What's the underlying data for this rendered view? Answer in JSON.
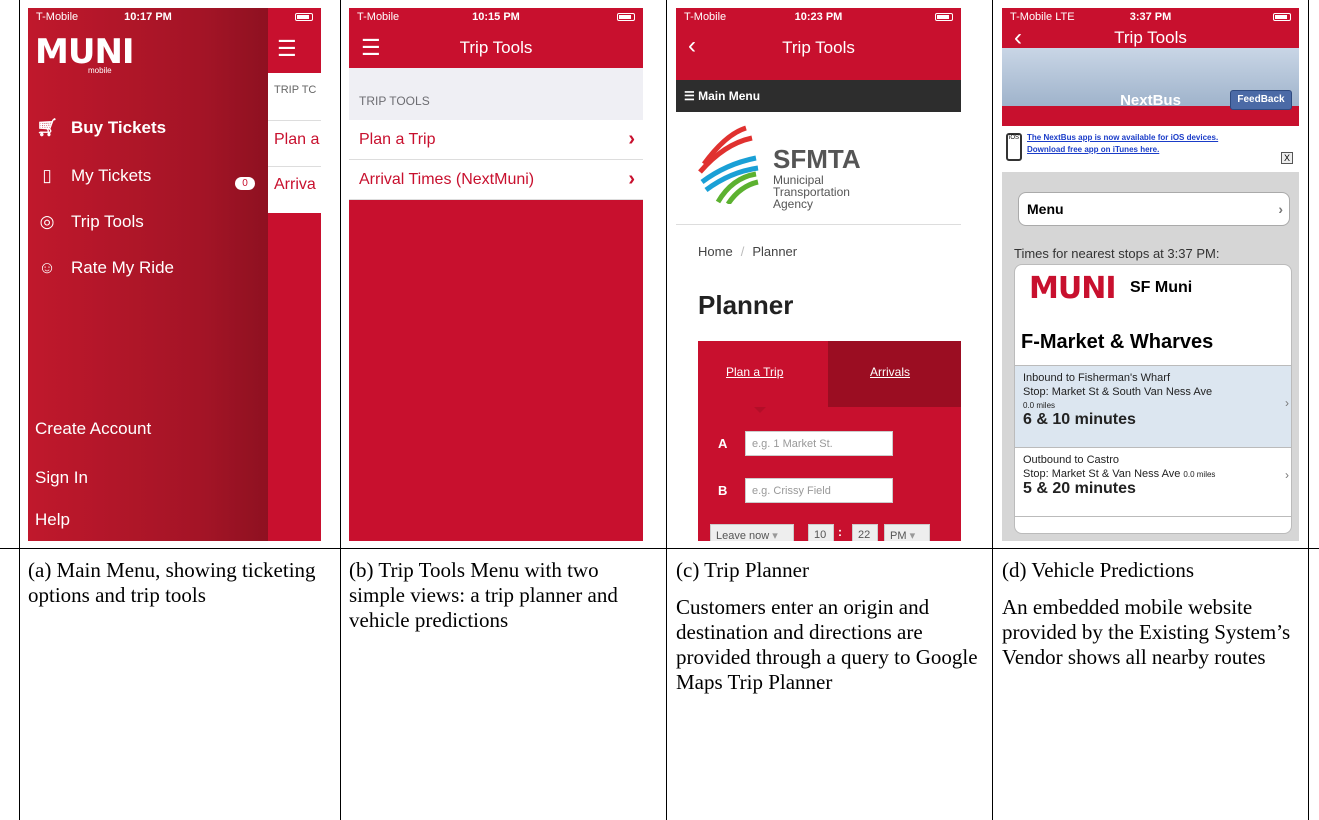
{
  "panel_a": {
    "status": {
      "carrier": "T-Mobile",
      "time": "10:17 PM"
    },
    "logo_text": "MUNI",
    "logo_sub": "mobile",
    "rest_header": "TRIP TC",
    "rest_row1": "Plan a",
    "rest_row2": "Arriva",
    "items": [
      {
        "icon": "cart-icon",
        "label": "Buy Tickets"
      },
      {
        "icon": "ticket-icon",
        "label": "My Tickets"
      },
      {
        "icon": "location-icon",
        "label": "Trip Tools"
      },
      {
        "icon": "smile-icon",
        "label": "Rate My Ride"
      }
    ],
    "ticket_count": "0",
    "bottom": [
      "Create Account",
      "Sign In",
      "Help"
    ],
    "caption": "(a) Main Menu, showing ticketing options and trip tools"
  },
  "panel_b": {
    "status": {
      "carrier": "T-Mobile",
      "time": "10:15 PM"
    },
    "title": "Trip Tools",
    "section": "TRIP TOOLS",
    "rows": [
      "Plan a Trip",
      "Arrival Times (NextMuni)"
    ],
    "caption": "(b) Trip Tools Menu with two simple views: a trip planner and vehicle predictions"
  },
  "panel_c": {
    "status": {
      "carrier": "T-Mobile",
      "time": "10:23 PM"
    },
    "title": "Trip Tools",
    "main_menu": "Main Menu",
    "sfmta": "SFMTA",
    "sfmta_sub": [
      "Municipal",
      "Transportation",
      "Agency"
    ],
    "crumb_home": "Home",
    "crumb_planner": "Planner",
    "planner_title": "Planner",
    "tab_plan": "Plan a Trip",
    "tab_arrivals": "Arrivals",
    "label_a": "A",
    "label_b": "B",
    "placeholder_a": "e.g. 1 Market St.",
    "placeholder_b": "e.g. Crissy Field",
    "leave": "Leave now",
    "hour": "10",
    "minute": "22",
    "ampm": "PM",
    "caption_title": "(c) Trip Planner",
    "caption_body": "Customers enter an origin and destination and directions are provided through a query to Google Maps Trip Planner"
  },
  "panel_d": {
    "status": {
      "carrier": "T-Mobile LTE",
      "time": "3:37 PM"
    },
    "title": "Trip Tools",
    "nextbus": "NextBus",
    "feedback": "FeedBack",
    "banner_ios": "iOS",
    "banner_l1": "The NextBus app is now available for iOS devices.",
    "banner_l2": "Download free app on iTunes here.",
    "banner_close": "X",
    "menu": "Menu",
    "times": "Times for nearest stops at 3:37 PM:",
    "muni": "MUNI",
    "agency": "SF Muni",
    "stop": "F-Market & Wharves",
    "pred1": {
      "dir": "Inbound to Fisherman's Wharf",
      "stop": "Stop: Market St & South Van Ness Ave",
      "dist": "0.0 miles",
      "mins": "6 & 10 minutes"
    },
    "pred2": {
      "dir": "Outbound to Castro",
      "stop": "Stop: Market St & Van Ness Ave",
      "dist": "0.0 miles",
      "mins": "5 & 20 minutes"
    },
    "caption_title": "(d) Vehicle Predictions",
    "caption_body": "An embedded mobile website provided by the Existing System’s Vendor shows all nearby routes"
  }
}
